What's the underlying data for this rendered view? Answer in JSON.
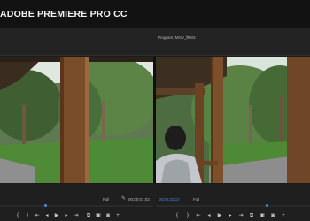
{
  "app": {
    "title": "ADOBE PREMIERE PRO CC"
  },
  "program_monitor": {
    "label": "Program: MOV_0003",
    "menu_icon": "chevron-right-icon"
  },
  "source_controls": {
    "fit_label": "Full",
    "timecode": "00;00;01;02",
    "wrench_icon": "wrench-icon"
  },
  "program_controls": {
    "playhead_timecode": "00;00;31;17",
    "fit_label": "Full",
    "playhead_color": "#4a90e2"
  },
  "transport_buttons": [
    {
      "name": "mark-in-icon",
      "glyph": "{"
    },
    {
      "name": "mark-out-icon",
      "glyph": "}"
    },
    {
      "name": "go-to-in-icon",
      "glyph": "⇤"
    },
    {
      "name": "step-back-icon",
      "glyph": "◂"
    },
    {
      "name": "play-icon",
      "glyph": "▶"
    },
    {
      "name": "step-forward-icon",
      "glyph": "▸"
    },
    {
      "name": "go-to-out-icon",
      "glyph": "⇥"
    },
    {
      "name": "insert-icon",
      "glyph": "⧉"
    },
    {
      "name": "overwrite-icon",
      "glyph": "▣"
    },
    {
      "name": "export-frame-icon",
      "glyph": "◙"
    },
    {
      "name": "button-editor-icon",
      "glyph": "+"
    }
  ],
  "colors": {
    "accent": "#4a90e2",
    "bg": "#1b1b1b"
  }
}
